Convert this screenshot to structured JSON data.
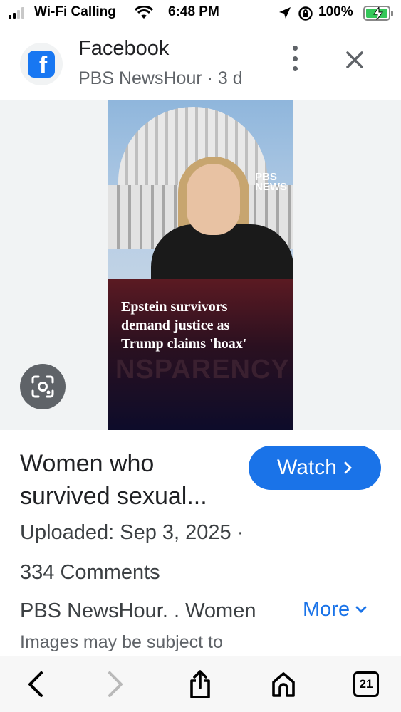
{
  "status_bar": {
    "carrier": "Wi-Fi Calling",
    "time": "6:48 PM",
    "battery": "100%"
  },
  "header": {
    "site_name": "Facebook",
    "subtitle": "PBS NewsHour · 3 d"
  },
  "media": {
    "caption_lines": [
      "Epstein survivors",
      "demand justice as",
      "Trump claims 'hoax'"
    ],
    "background_text": "NSPARENCY ACT",
    "watermark": "PBS NEWS"
  },
  "result": {
    "title": "Women who survived sexual...",
    "watch_label": "Watch",
    "uploaded": "Uploaded: Sep 3, 2025 ·",
    "comments": "334 Comments",
    "description": "PBS NewsHour. . Women",
    "more_label": "More",
    "disclaimer": "Images may be subject to"
  },
  "toolbar": {
    "tab_count": "21"
  },
  "colors": {
    "accent": "#1a73e8",
    "facebook_blue": "#1877f2",
    "battery_green": "#34c759"
  }
}
